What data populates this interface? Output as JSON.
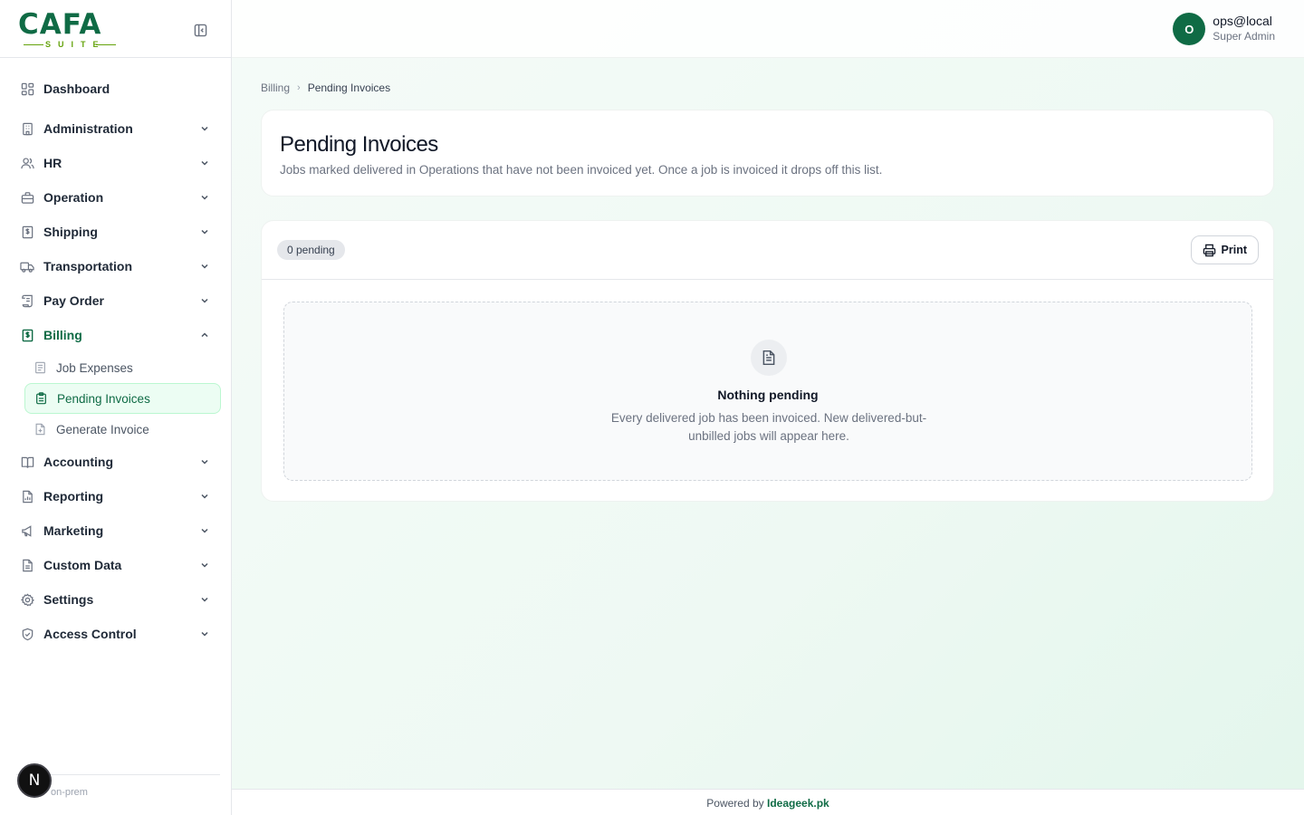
{
  "sidebar": {
    "logo": {
      "main": "CAFA",
      "sub": "SUITE"
    },
    "collapse_icon": "panel-left-icon",
    "items": [
      {
        "label": "Dashboard",
        "icon": "grid-icon",
        "has_chevron": false
      },
      {
        "label": "Administration",
        "icon": "building-icon",
        "has_chevron": true
      },
      {
        "label": "HR",
        "icon": "users-icon",
        "has_chevron": true
      },
      {
        "label": "Operation",
        "icon": "briefcase-icon",
        "has_chevron": true
      },
      {
        "label": "Shipping",
        "icon": "ship-doc-icon",
        "has_chevron": true
      },
      {
        "label": "Transportation",
        "icon": "truck-icon",
        "has_chevron": true
      },
      {
        "label": "Pay Order",
        "icon": "scroll-icon",
        "has_chevron": true
      },
      {
        "label": "Billing",
        "icon": "dollar-doc-icon",
        "has_chevron": true,
        "expanded": true
      },
      {
        "label": "Accounting",
        "icon": "book-icon",
        "has_chevron": true
      },
      {
        "label": "Reporting",
        "icon": "chart-doc-icon",
        "has_chevron": true
      },
      {
        "label": "Marketing",
        "icon": "megaphone-icon",
        "has_chevron": true
      },
      {
        "label": "Custom Data",
        "icon": "file-icon",
        "has_chevron": true
      },
      {
        "label": "Settings",
        "icon": "gear-icon",
        "has_chevron": true
      },
      {
        "label": "Access Control",
        "icon": "shield-icon",
        "has_chevron": true
      }
    ],
    "billing_sub": [
      {
        "label": "Job Expenses",
        "icon": "receipt-icon"
      },
      {
        "label": "Pending Invoices",
        "icon": "clipboard-icon",
        "active": true
      },
      {
        "label": "Generate Invoice",
        "icon": "file-plus-icon"
      }
    ],
    "version": "on-prem",
    "badge": "N"
  },
  "topbar": {
    "avatar_initial": "O",
    "user_name": "ops@local",
    "user_role": "Super Admin"
  },
  "breadcrumb": {
    "parent": "Billing",
    "current": "Pending Invoices"
  },
  "header": {
    "title": "Pending Invoices",
    "description": "Jobs marked delivered in Operations that have not been invoiced yet. Once a job is invoiced it drops off this list."
  },
  "toolbar": {
    "pending_count": "0 pending",
    "print_label": "Print"
  },
  "empty_state": {
    "icon": "document-icon",
    "title": "Nothing pending",
    "description": "Every delivered job has been invoiced. New delivered-but-unbilled jobs will appear here."
  },
  "footer": {
    "prefix": "Powered by",
    "brand": "Ideageek.pk"
  },
  "colors": {
    "brand": "#0f6b45",
    "accent": "#65a30d"
  }
}
